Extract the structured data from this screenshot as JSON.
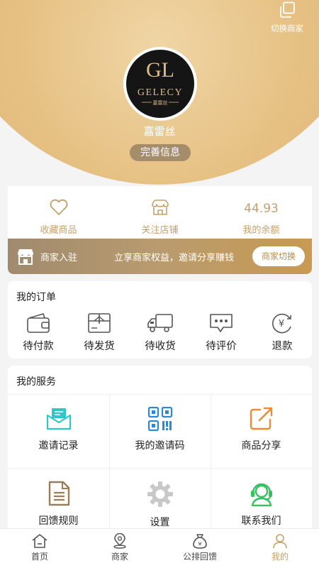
{
  "header": {
    "switch_label": "切换商家",
    "username": "嘉雷丝",
    "complete_info": "完善信息",
    "logo": {
      "monogram": "GL",
      "brand": "GELECY",
      "sub": "嘉雷丝"
    }
  },
  "stats": {
    "favorites_label": "收藏商品",
    "follow_label": "关注店铺",
    "balance_value": "44.93",
    "balance_label": "我的余额"
  },
  "merchant_bar": {
    "title": "商家入驻",
    "desc": "立享商家权益，邀请分享赚钱",
    "button": "商家切换"
  },
  "orders": {
    "title": "我的订单",
    "items": [
      {
        "label": "待付款",
        "icon": "wallet-icon"
      },
      {
        "label": "待发货",
        "icon": "box-icon"
      },
      {
        "label": "待收货",
        "icon": "truck-icon"
      },
      {
        "label": "待评价",
        "icon": "chat-bubble-icon"
      },
      {
        "label": "退款",
        "icon": "refund-yen-icon"
      }
    ]
  },
  "services": {
    "title": "我的服务",
    "items": [
      {
        "label": "邀请记录",
        "icon": "envelope-icon"
      },
      {
        "label": "我的邀请码",
        "icon": "qr-code-icon"
      },
      {
        "label": "商品分享",
        "icon": "share-icon"
      },
      {
        "label": "回馈规则",
        "icon": "document-icon"
      },
      {
        "label": "设置",
        "icon": "gear-icon"
      },
      {
        "label": "联系我们",
        "icon": "customer-service-icon"
      }
    ]
  },
  "tabbar": {
    "items": [
      {
        "label": "首页",
        "icon": "home-icon"
      },
      {
        "label": "商家",
        "icon": "location-pin-icon"
      },
      {
        "label": "公排回馈",
        "icon": "money-bag-icon"
      },
      {
        "label": "我的",
        "icon": "user-icon"
      }
    ],
    "active_index": 3
  },
  "colors": {
    "gold": "#c5a06a",
    "header_bg": "#e0b876",
    "teal": "#2ec6c9",
    "blue": "#2b88d8",
    "orange": "#f08a30",
    "brown": "#9b7d56",
    "green": "#35c25f"
  }
}
